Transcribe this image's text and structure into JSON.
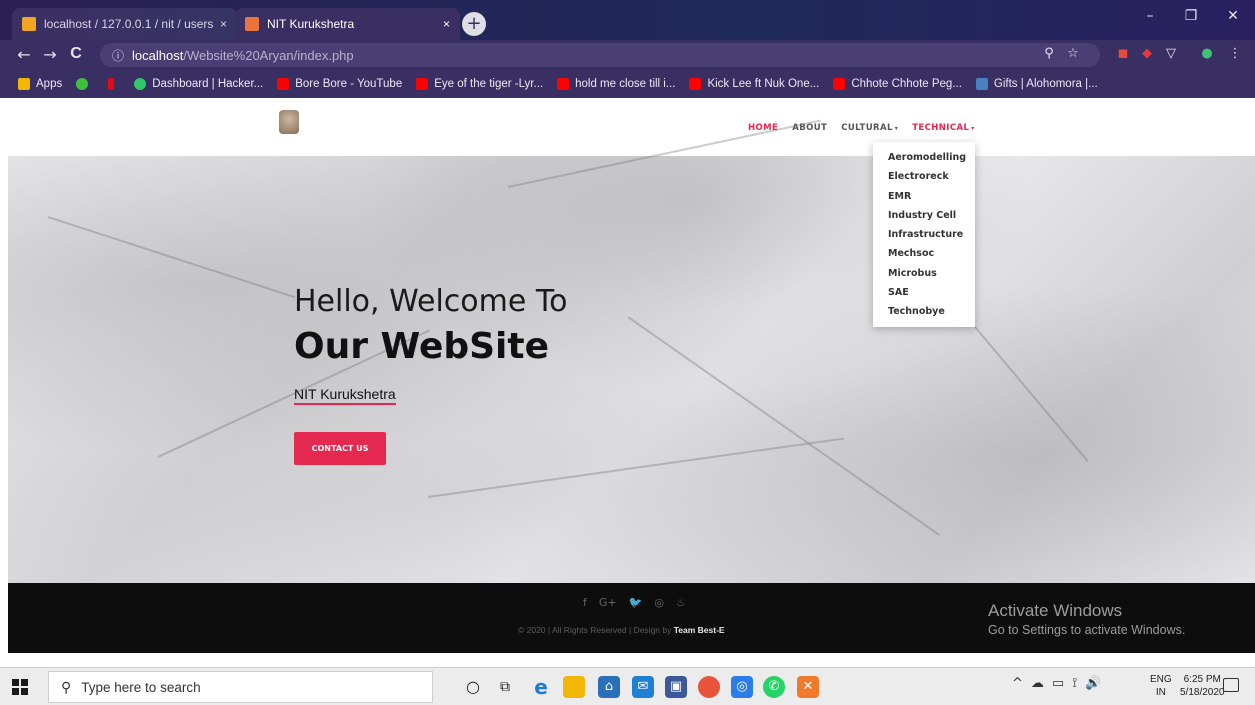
{
  "browser": {
    "tabs": [
      {
        "label": "localhost / 127.0.0.1 / nit / users",
        "close": "×"
      },
      {
        "label": "NIT Kurukshetra",
        "close": "×"
      }
    ],
    "new_tab_glyph": "+",
    "window_controls": {
      "minimize": "–",
      "maximize": "❐",
      "close": "✕"
    },
    "nav": {
      "back": "←",
      "forward": "→",
      "reload": "C"
    },
    "address": {
      "info": "ⓘ",
      "host": "localhost",
      "path": "/Website%20Aryan/index.php"
    },
    "toolbar_icons": {
      "zoom": "⚲",
      "star": "☆",
      "menu": "⋮"
    },
    "bookmarks": [
      {
        "label": "Apps",
        "icon": "apps-grid-icon",
        "color": "#f2b705"
      },
      {
        "label": "",
        "icon": "green-play-icon",
        "color": "#3ec13e"
      },
      {
        "label": "",
        "icon": "netflix-icon",
        "color": "#e50914"
      },
      {
        "label": "Dashboard | Hacker...",
        "icon": "hackerrank-icon",
        "color": "#2ec866"
      },
      {
        "label": "Bore Bore - YouTube",
        "icon": "youtube-icon",
        "color": "#ff0000"
      },
      {
        "label": "Eye of the tiger -Lyr...",
        "icon": "youtube-icon",
        "color": "#ff0000"
      },
      {
        "label": "hold me close till i...",
        "icon": "youtube-icon",
        "color": "#ff0000"
      },
      {
        "label": "Kick Lee ft Nuk One...",
        "icon": "youtube-icon",
        "color": "#ff0000"
      },
      {
        "label": "Chhote Chhote Peg...",
        "icon": "youtube-icon",
        "color": "#ff0000"
      },
      {
        "label": "Gifts | Alohomora |...",
        "icon": "gift-icon",
        "color": "#4a7fc1"
      }
    ]
  },
  "site": {
    "nav": [
      {
        "label": "HOME",
        "active": true
      },
      {
        "label": "ABOUT",
        "active": false
      },
      {
        "label": "CULTURAL",
        "caret": "▾",
        "active": false
      },
      {
        "label": "TECHNICAL",
        "caret": "▾",
        "active": true
      }
    ],
    "dropdown": [
      "Aeromodelling",
      "Electroreck",
      "EMR",
      "Industry Cell",
      "Infrastructure",
      "Mechsoc",
      "Microbus",
      "SAE",
      "Technobye"
    ],
    "hero": {
      "line1": "Hello, Welcome To",
      "line2": "Our WebSite",
      "subtitle": "NIT Kurukshetra",
      "button": "CONTACT US"
    },
    "footer": {
      "social": [
        "f",
        "G+",
        "🐦",
        "◎",
        "♨"
      ],
      "copyright": "© 2020 | All Rights Reserved | Design by ",
      "team": "Team Best-E"
    }
  },
  "watermark": {
    "title": "Activate Windows",
    "subtitle": "Go to Settings to activate Windows."
  },
  "taskbar": {
    "search_placeholder": "Type here to search",
    "search_glyph": "⚲",
    "lang_top": "ENG",
    "lang_bottom": "IN",
    "time": "6:25 PM",
    "date": "5/18/2020",
    "tray": [
      "^",
      "☁",
      "▭",
      "⟟",
      "🔊"
    ]
  },
  "colors": {
    "accent": "#e4284f",
    "chrome": "#3a2f63"
  }
}
